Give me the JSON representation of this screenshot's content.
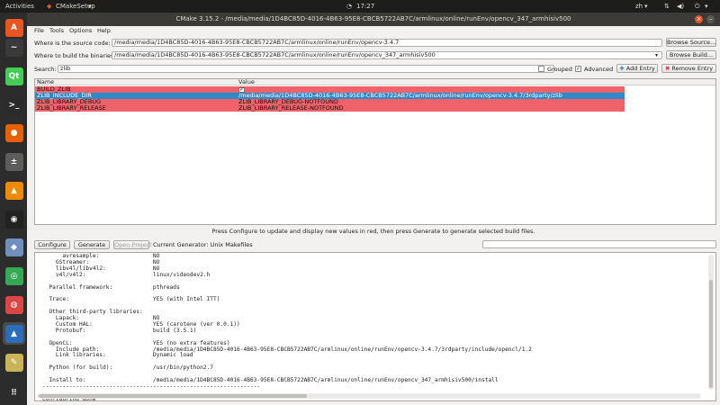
{
  "topbar": {
    "activities": "Activities",
    "app_name": "CMakeSetup",
    "clock": "17:27",
    "lang": "zh",
    "lang_chevron": "▾",
    "power_chevron": "▾"
  },
  "window": {
    "title": "CMake 3.15.2 - /media/media/1D4BC85D-4016-4B63-95E8-CBCB5722AB7C/armlinux/online/runEnv/opencv_347_armhisiv500"
  },
  "menu": [
    "File",
    "Tools",
    "Options",
    "Help"
  ],
  "source": {
    "label": "Where is the source code:",
    "value": "/media/media/1D4BC85D-4016-4B63-95E8-CBCB5722AB7C/armlinux/online/runEnv/opencv-3.4.7",
    "button": "Browse Source..."
  },
  "binary": {
    "label": "Where to build the binaries:",
    "value": "/media/media/1D4BC85D-4016-4B63-95E8-CBCB5722AB7C/armlinux/online/runEnv/opencv_347_armhisiv500",
    "button": "Browse Build..."
  },
  "search": {
    "label": "Search:",
    "value": "zlib",
    "grouped": "Grouped",
    "advanced": "Advanced",
    "add_entry": "Add Entry",
    "remove_entry": "Remove Entry"
  },
  "table": {
    "headers": [
      "Name",
      "Value"
    ],
    "rows": [
      {
        "name": "BUILD_ZLIB",
        "value": "✓",
        "state": "red"
      },
      {
        "name": "ZLIB_INCLUDE_DIR",
        "value": "/media/media/1D4BC85D-4016-4B63-95E8-CBCB5722AB7C/armlinux/online/runEnv/opencv-3.4.7/3rdparty/zlib",
        "state": "selected"
      },
      {
        "name": "ZLIB_LIBRARY_DEBUG",
        "value": "ZLIB_LIBRARY_DEBUG-NOTFOUND",
        "state": "red"
      },
      {
        "name": "ZLIB_LIBRARY_RELEASE",
        "value": "ZLIB_LIBRARY_RELEASE-NOTFOUND",
        "state": "red"
      }
    ]
  },
  "message": "Press Configure to update and display new values in red, then press Generate to generate selected build files.",
  "actions": {
    "configure": "Configure",
    "generate": "Generate",
    "open_project": "Open Project",
    "generator": "Current Generator: Unix Makefiles"
  },
  "output_lines": [
    "      avresample:                NO",
    "    GStreamer:                   NO",
    "    libv4l/libv4l2:              NO",
    "    v4l/v4l2:                    linux/videodev2.h",
    "",
    "  Parallel framework:            pthreads",
    "",
    "  Trace:                         YES (with Intel ITT)",
    "",
    "  Other third-party libraries:",
    "    Lapack:                      NO",
    "    Custom HAL:                  YES (carotene (ver 0.0.1))",
    "    Protobuf:                    build (3.5.1)",
    "",
    "  OpenCL:                        YES (no extra features)",
    "    Include path:                /media/media/1D4BC85D-4016-4B63-95E8-CBCB5722AB7C/armlinux/online/runEnv/opencv-3.4.7/3rdparty/include/opencl/1.2",
    "    Link libraries:              Dynamic load",
    "",
    "  Python (for build):            /usr/bin/python2.7",
    "",
    "  Install to:                    /media/media/1D4BC85D-4016-4B63-95E8-CBCB5722AB7C/armlinux/online/runEnv/opencv_347_armhisiv500/install",
    "-----------------------------------------------------------------",
    "",
    "Configuring done"
  ],
  "dock": [
    {
      "name": "ubuntu-software-icon",
      "color": "#e95420",
      "glyph": "A"
    },
    {
      "name": "system-monitor-icon",
      "color": "#3a3a3a",
      "glyph": "~"
    },
    {
      "name": "qt-creator-icon",
      "color": "#41cd52",
      "glyph": "Qt"
    },
    {
      "name": "terminal-icon",
      "color": "#2b2b2b",
      "glyph": ">_"
    },
    {
      "name": "firefox-icon",
      "color": "#e66000",
      "glyph": "●"
    },
    {
      "name": "calculator-icon",
      "color": "#5c5c5c",
      "glyph": "±"
    },
    {
      "name": "vlc-icon",
      "color": "#f08a00",
      "glyph": "▲"
    },
    {
      "name": "media-player-icon",
      "color": "#222",
      "glyph": "◉"
    },
    {
      "name": "files-icon",
      "color": "#6f8fbf",
      "glyph": "◆"
    },
    {
      "name": "chrome-icon",
      "color": "#34a853",
      "glyph": "◎"
    },
    {
      "name": "synaptic-icon",
      "color": "#d44",
      "glyph": "◍"
    },
    {
      "name": "cmake-icon",
      "color": "#2a6ebb",
      "glyph": "▲"
    },
    {
      "name": "draw-icon",
      "color": "#c9b458",
      "glyph": "✎"
    },
    {
      "name": "trash-icon",
      "color": "#555",
      "glyph": "🗑"
    },
    {
      "name": "show-apps-icon",
      "color": "#2c2c2c",
      "glyph": "⠿"
    }
  ]
}
